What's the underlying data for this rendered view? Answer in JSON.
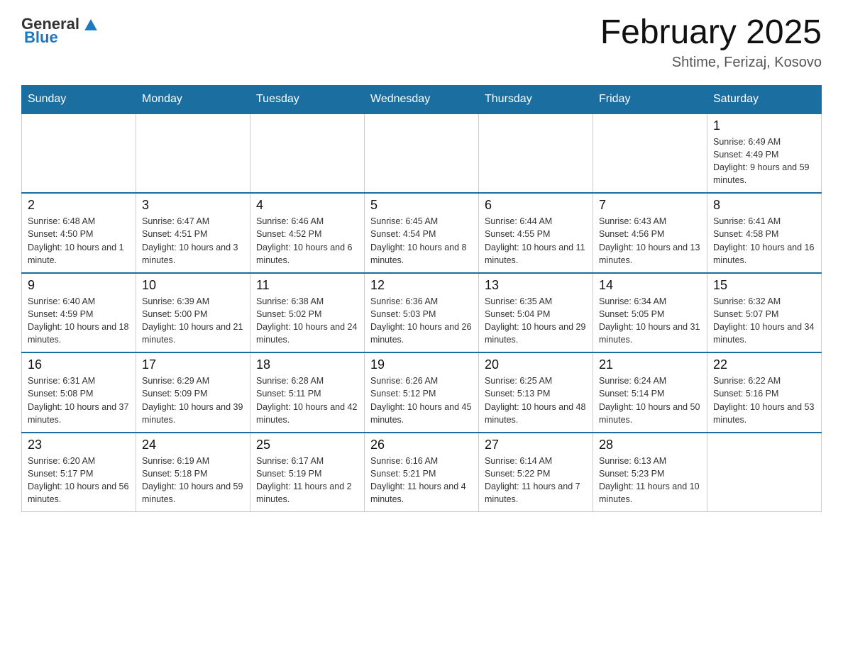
{
  "header": {
    "logo_general": "General",
    "logo_blue": "Blue",
    "title": "February 2025",
    "location": "Shtime, Ferizaj, Kosovo"
  },
  "days_of_week": [
    "Sunday",
    "Monday",
    "Tuesday",
    "Wednesday",
    "Thursday",
    "Friday",
    "Saturday"
  ],
  "weeks": [
    {
      "days": [
        {
          "number": "",
          "info": ""
        },
        {
          "number": "",
          "info": ""
        },
        {
          "number": "",
          "info": ""
        },
        {
          "number": "",
          "info": ""
        },
        {
          "number": "",
          "info": ""
        },
        {
          "number": "",
          "info": ""
        },
        {
          "number": "1",
          "info": "Sunrise: 6:49 AM\nSunset: 4:49 PM\nDaylight: 9 hours and 59 minutes."
        }
      ]
    },
    {
      "days": [
        {
          "number": "2",
          "info": "Sunrise: 6:48 AM\nSunset: 4:50 PM\nDaylight: 10 hours and 1 minute."
        },
        {
          "number": "3",
          "info": "Sunrise: 6:47 AM\nSunset: 4:51 PM\nDaylight: 10 hours and 3 minutes."
        },
        {
          "number": "4",
          "info": "Sunrise: 6:46 AM\nSunset: 4:52 PM\nDaylight: 10 hours and 6 minutes."
        },
        {
          "number": "5",
          "info": "Sunrise: 6:45 AM\nSunset: 4:54 PM\nDaylight: 10 hours and 8 minutes."
        },
        {
          "number": "6",
          "info": "Sunrise: 6:44 AM\nSunset: 4:55 PM\nDaylight: 10 hours and 11 minutes."
        },
        {
          "number": "7",
          "info": "Sunrise: 6:43 AM\nSunset: 4:56 PM\nDaylight: 10 hours and 13 minutes."
        },
        {
          "number": "8",
          "info": "Sunrise: 6:41 AM\nSunset: 4:58 PM\nDaylight: 10 hours and 16 minutes."
        }
      ]
    },
    {
      "days": [
        {
          "number": "9",
          "info": "Sunrise: 6:40 AM\nSunset: 4:59 PM\nDaylight: 10 hours and 18 minutes."
        },
        {
          "number": "10",
          "info": "Sunrise: 6:39 AM\nSunset: 5:00 PM\nDaylight: 10 hours and 21 minutes."
        },
        {
          "number": "11",
          "info": "Sunrise: 6:38 AM\nSunset: 5:02 PM\nDaylight: 10 hours and 24 minutes."
        },
        {
          "number": "12",
          "info": "Sunrise: 6:36 AM\nSunset: 5:03 PM\nDaylight: 10 hours and 26 minutes."
        },
        {
          "number": "13",
          "info": "Sunrise: 6:35 AM\nSunset: 5:04 PM\nDaylight: 10 hours and 29 minutes."
        },
        {
          "number": "14",
          "info": "Sunrise: 6:34 AM\nSunset: 5:05 PM\nDaylight: 10 hours and 31 minutes."
        },
        {
          "number": "15",
          "info": "Sunrise: 6:32 AM\nSunset: 5:07 PM\nDaylight: 10 hours and 34 minutes."
        }
      ]
    },
    {
      "days": [
        {
          "number": "16",
          "info": "Sunrise: 6:31 AM\nSunset: 5:08 PM\nDaylight: 10 hours and 37 minutes."
        },
        {
          "number": "17",
          "info": "Sunrise: 6:29 AM\nSunset: 5:09 PM\nDaylight: 10 hours and 39 minutes."
        },
        {
          "number": "18",
          "info": "Sunrise: 6:28 AM\nSunset: 5:11 PM\nDaylight: 10 hours and 42 minutes."
        },
        {
          "number": "19",
          "info": "Sunrise: 6:26 AM\nSunset: 5:12 PM\nDaylight: 10 hours and 45 minutes."
        },
        {
          "number": "20",
          "info": "Sunrise: 6:25 AM\nSunset: 5:13 PM\nDaylight: 10 hours and 48 minutes."
        },
        {
          "number": "21",
          "info": "Sunrise: 6:24 AM\nSunset: 5:14 PM\nDaylight: 10 hours and 50 minutes."
        },
        {
          "number": "22",
          "info": "Sunrise: 6:22 AM\nSunset: 5:16 PM\nDaylight: 10 hours and 53 minutes."
        }
      ]
    },
    {
      "days": [
        {
          "number": "23",
          "info": "Sunrise: 6:20 AM\nSunset: 5:17 PM\nDaylight: 10 hours and 56 minutes."
        },
        {
          "number": "24",
          "info": "Sunrise: 6:19 AM\nSunset: 5:18 PM\nDaylight: 10 hours and 59 minutes."
        },
        {
          "number": "25",
          "info": "Sunrise: 6:17 AM\nSunset: 5:19 PM\nDaylight: 11 hours and 2 minutes."
        },
        {
          "number": "26",
          "info": "Sunrise: 6:16 AM\nSunset: 5:21 PM\nDaylight: 11 hours and 4 minutes."
        },
        {
          "number": "27",
          "info": "Sunrise: 6:14 AM\nSunset: 5:22 PM\nDaylight: 11 hours and 7 minutes."
        },
        {
          "number": "28",
          "info": "Sunrise: 6:13 AM\nSunset: 5:23 PM\nDaylight: 11 hours and 10 minutes."
        },
        {
          "number": "",
          "info": ""
        }
      ]
    }
  ]
}
